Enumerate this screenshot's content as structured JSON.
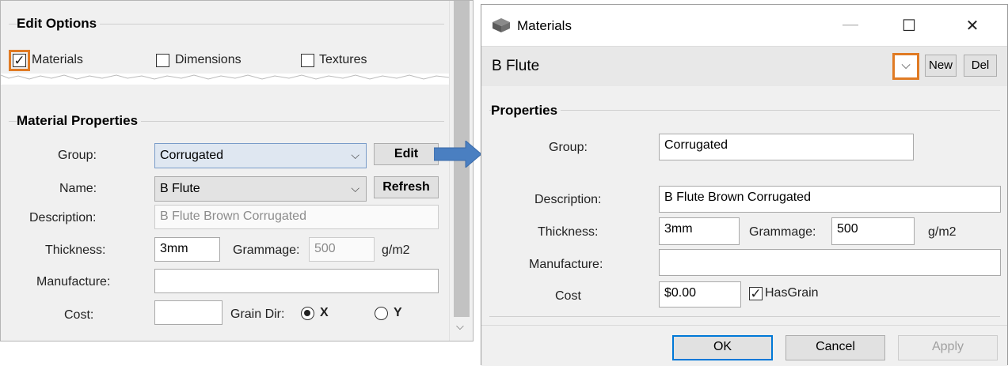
{
  "left_panel": {
    "edit_options_title": "Edit Options",
    "options": [
      {
        "label": "Materials",
        "checked": true
      },
      {
        "label": "Dimensions",
        "checked": false
      },
      {
        "label": "Textures",
        "checked": false
      }
    ],
    "material_properties_title": "Material Properties",
    "group_label": "Group:",
    "group_value": "Corrugated",
    "edit_button": "Edit",
    "name_label": "Name:",
    "name_value": "B Flute",
    "refresh_button": "Refresh",
    "description_label": "Description:",
    "description_value": "B Flute Brown Corrugated",
    "thickness_label": "Thickness:",
    "thickness_value": "3mm",
    "grammage_label": "Grammage:",
    "grammage_value": "500",
    "grammage_unit": "g/m2",
    "manufacture_label": "Manufacture:",
    "manufacture_value": "",
    "cost_label": "Cost:",
    "cost_value": "",
    "grain_dir_label": "Grain Dir:",
    "grain_x": "X",
    "grain_y": "Y",
    "grain_selected": "X"
  },
  "dialog": {
    "title": "Materials",
    "window_buttons": {
      "minimize": "—",
      "maximize": "☐",
      "close": "✕"
    },
    "material_select_value": "B Flute",
    "new_button": "New",
    "del_button": "Del",
    "properties_title": "Properties",
    "group_label": "Group:",
    "group_value": "Corrugated",
    "description_label": "Description:",
    "description_value": "B Flute Brown Corrugated",
    "thickness_label": "Thickness:",
    "thickness_value": "3mm",
    "grammage_label": "Grammage:",
    "grammage_value": "500",
    "grammage_unit": "g/m2",
    "manufacture_label": "Manufacture:",
    "manufacture_value": "",
    "cost_label": "Cost",
    "cost_value": "$0.00",
    "has_grain_label": "HasGrain",
    "has_grain_checked": true,
    "ok_button": "OK",
    "cancel_button": "Cancel",
    "apply_button": "Apply"
  },
  "colors": {
    "highlight": "#e07b24",
    "arrow": "#4a7fc1",
    "primary_button_border": "#0078d7"
  },
  "icons": {
    "chevron": "⌵",
    "check": "✓",
    "materials_icon": "stack-icon"
  }
}
